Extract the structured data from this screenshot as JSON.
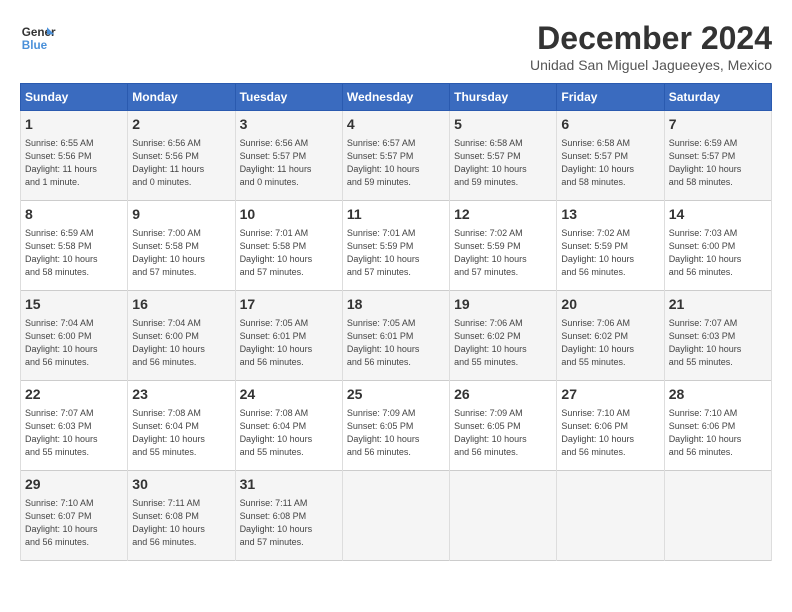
{
  "logo": {
    "line1": "General",
    "line2": "Blue"
  },
  "title": "December 2024",
  "location": "Unidad San Miguel Jagueeyes, Mexico",
  "columns": [
    "Sunday",
    "Monday",
    "Tuesday",
    "Wednesday",
    "Thursday",
    "Friday",
    "Saturday"
  ],
  "weeks": [
    [
      {
        "day": "1",
        "info": "Sunrise: 6:55 AM\nSunset: 5:56 PM\nDaylight: 11 hours\nand 1 minute."
      },
      {
        "day": "2",
        "info": "Sunrise: 6:56 AM\nSunset: 5:56 PM\nDaylight: 11 hours\nand 0 minutes."
      },
      {
        "day": "3",
        "info": "Sunrise: 6:56 AM\nSunset: 5:57 PM\nDaylight: 11 hours\nand 0 minutes."
      },
      {
        "day": "4",
        "info": "Sunrise: 6:57 AM\nSunset: 5:57 PM\nDaylight: 10 hours\nand 59 minutes."
      },
      {
        "day": "5",
        "info": "Sunrise: 6:58 AM\nSunset: 5:57 PM\nDaylight: 10 hours\nand 59 minutes."
      },
      {
        "day": "6",
        "info": "Sunrise: 6:58 AM\nSunset: 5:57 PM\nDaylight: 10 hours\nand 58 minutes."
      },
      {
        "day": "7",
        "info": "Sunrise: 6:59 AM\nSunset: 5:57 PM\nDaylight: 10 hours\nand 58 minutes."
      }
    ],
    [
      {
        "day": "8",
        "info": "Sunrise: 6:59 AM\nSunset: 5:58 PM\nDaylight: 10 hours\nand 58 minutes."
      },
      {
        "day": "9",
        "info": "Sunrise: 7:00 AM\nSunset: 5:58 PM\nDaylight: 10 hours\nand 57 minutes."
      },
      {
        "day": "10",
        "info": "Sunrise: 7:01 AM\nSunset: 5:58 PM\nDaylight: 10 hours\nand 57 minutes."
      },
      {
        "day": "11",
        "info": "Sunrise: 7:01 AM\nSunset: 5:59 PM\nDaylight: 10 hours\nand 57 minutes."
      },
      {
        "day": "12",
        "info": "Sunrise: 7:02 AM\nSunset: 5:59 PM\nDaylight: 10 hours\nand 57 minutes."
      },
      {
        "day": "13",
        "info": "Sunrise: 7:02 AM\nSunset: 5:59 PM\nDaylight: 10 hours\nand 56 minutes."
      },
      {
        "day": "14",
        "info": "Sunrise: 7:03 AM\nSunset: 6:00 PM\nDaylight: 10 hours\nand 56 minutes."
      }
    ],
    [
      {
        "day": "15",
        "info": "Sunrise: 7:04 AM\nSunset: 6:00 PM\nDaylight: 10 hours\nand 56 minutes."
      },
      {
        "day": "16",
        "info": "Sunrise: 7:04 AM\nSunset: 6:00 PM\nDaylight: 10 hours\nand 56 minutes."
      },
      {
        "day": "17",
        "info": "Sunrise: 7:05 AM\nSunset: 6:01 PM\nDaylight: 10 hours\nand 56 minutes."
      },
      {
        "day": "18",
        "info": "Sunrise: 7:05 AM\nSunset: 6:01 PM\nDaylight: 10 hours\nand 56 minutes."
      },
      {
        "day": "19",
        "info": "Sunrise: 7:06 AM\nSunset: 6:02 PM\nDaylight: 10 hours\nand 55 minutes."
      },
      {
        "day": "20",
        "info": "Sunrise: 7:06 AM\nSunset: 6:02 PM\nDaylight: 10 hours\nand 55 minutes."
      },
      {
        "day": "21",
        "info": "Sunrise: 7:07 AM\nSunset: 6:03 PM\nDaylight: 10 hours\nand 55 minutes."
      }
    ],
    [
      {
        "day": "22",
        "info": "Sunrise: 7:07 AM\nSunset: 6:03 PM\nDaylight: 10 hours\nand 55 minutes."
      },
      {
        "day": "23",
        "info": "Sunrise: 7:08 AM\nSunset: 6:04 PM\nDaylight: 10 hours\nand 55 minutes."
      },
      {
        "day": "24",
        "info": "Sunrise: 7:08 AM\nSunset: 6:04 PM\nDaylight: 10 hours\nand 55 minutes."
      },
      {
        "day": "25",
        "info": "Sunrise: 7:09 AM\nSunset: 6:05 PM\nDaylight: 10 hours\nand 56 minutes."
      },
      {
        "day": "26",
        "info": "Sunrise: 7:09 AM\nSunset: 6:05 PM\nDaylight: 10 hours\nand 56 minutes."
      },
      {
        "day": "27",
        "info": "Sunrise: 7:10 AM\nSunset: 6:06 PM\nDaylight: 10 hours\nand 56 minutes."
      },
      {
        "day": "28",
        "info": "Sunrise: 7:10 AM\nSunset: 6:06 PM\nDaylight: 10 hours\nand 56 minutes."
      }
    ],
    [
      {
        "day": "29",
        "info": "Sunrise: 7:10 AM\nSunset: 6:07 PM\nDaylight: 10 hours\nand 56 minutes."
      },
      {
        "day": "30",
        "info": "Sunrise: 7:11 AM\nSunset: 6:08 PM\nDaylight: 10 hours\nand 56 minutes."
      },
      {
        "day": "31",
        "info": "Sunrise: 7:11 AM\nSunset: 6:08 PM\nDaylight: 10 hours\nand 57 minutes."
      },
      {
        "day": "",
        "info": ""
      },
      {
        "day": "",
        "info": ""
      },
      {
        "day": "",
        "info": ""
      },
      {
        "day": "",
        "info": ""
      }
    ]
  ]
}
